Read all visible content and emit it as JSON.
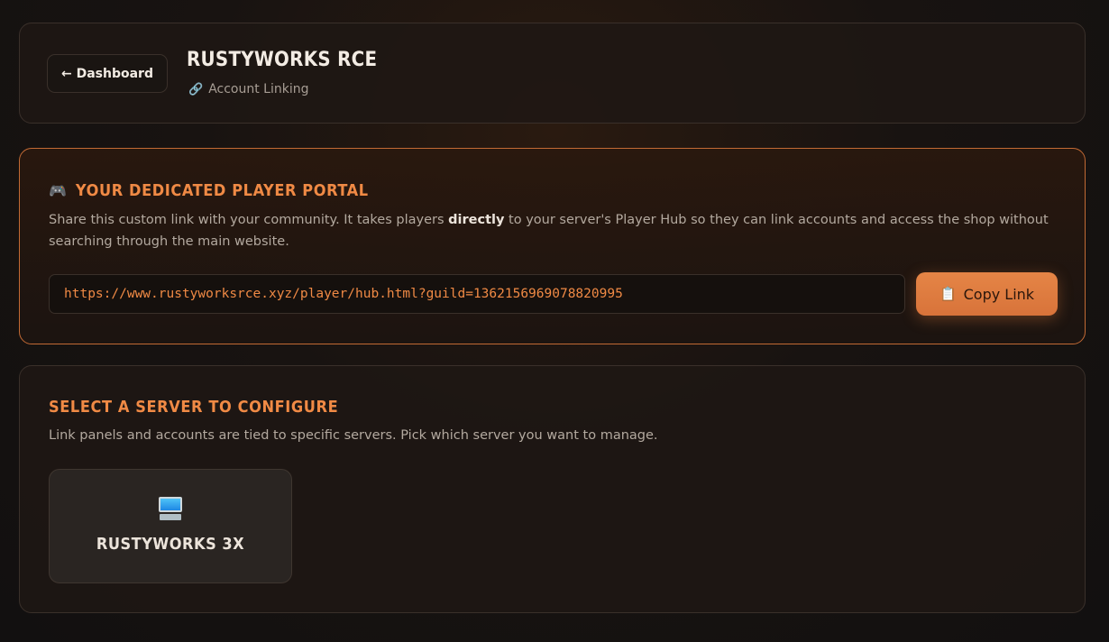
{
  "header": {
    "back_label": "← Dashboard",
    "app_title": "RUSTYWORKS RCE",
    "subtitle_icon": "link-icon",
    "subtitle": "Account Linking"
  },
  "portal": {
    "heading_icon": "gamepad-icon",
    "title": "YOUR DEDICATED PLAYER PORTAL",
    "desc_before": "Share this custom link with your community. It takes players ",
    "desc_bold": "directly",
    "desc_after": " to your server's Player Hub so they can link accounts and access the shop without searching through the main website.",
    "link_value": "https://www.rustyworksrce.xyz/player/hub.html?guild=1362156969078820995",
    "copy_icon": "clipboard-icon",
    "copy_label": "Copy Link"
  },
  "servers": {
    "title": "SELECT A SERVER TO CONFIGURE",
    "description": "Link panels and accounts are tied to specific servers. Pick which server you want to manage.",
    "items": [
      {
        "icon": "monitor-icon",
        "name": "RUSTYWORKS 3X"
      }
    ]
  },
  "colors": {
    "accent": "#f08a45",
    "button": "#e07c3f",
    "background": "#141110"
  }
}
